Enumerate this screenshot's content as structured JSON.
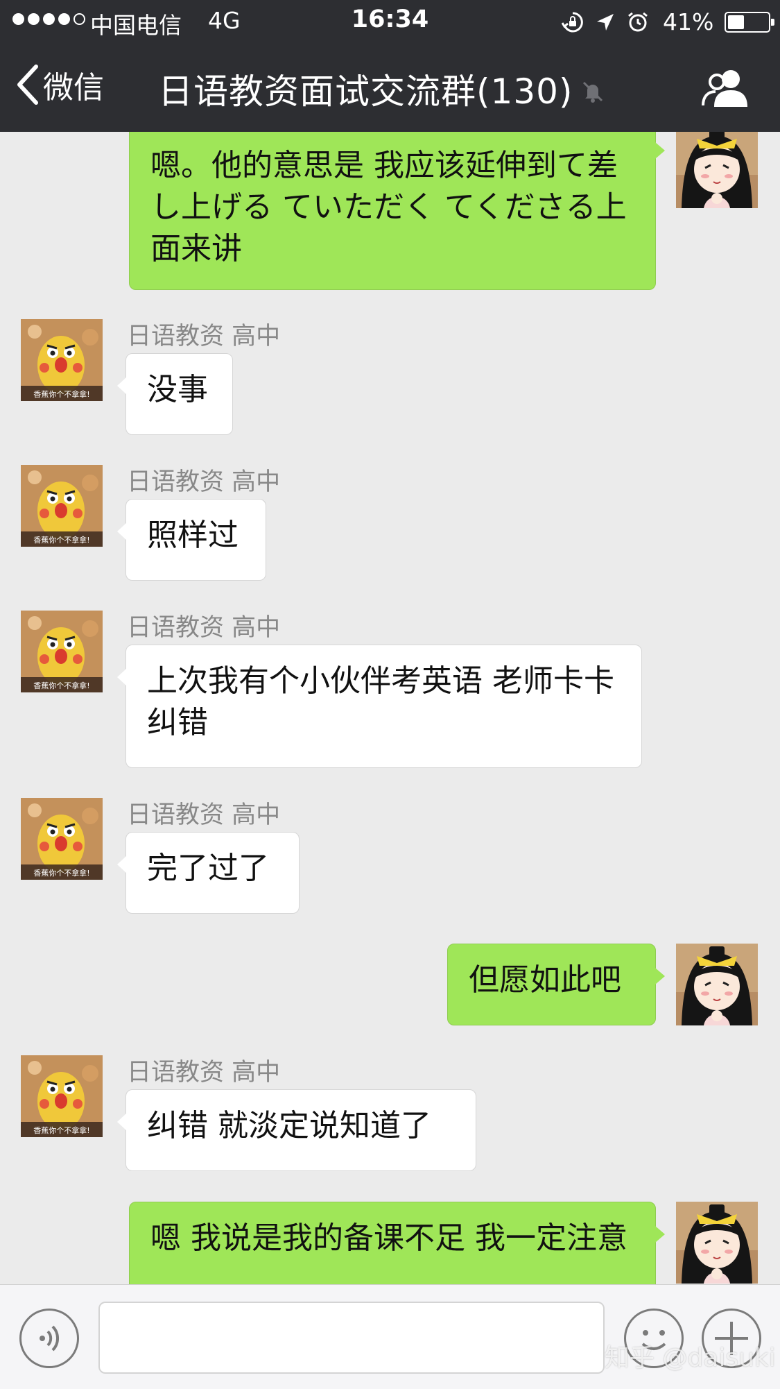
{
  "status_bar": {
    "carrier": "中国电信",
    "network": "4G",
    "time": "16:34",
    "battery_percent_text": "41%",
    "battery_level": 0.41,
    "icons": [
      "signal-dots-icon",
      "orientation-lock-icon",
      "location-arrow-icon",
      "alarm-icon",
      "battery-icon"
    ]
  },
  "nav": {
    "back_label": "微信",
    "title": "日语教资面试交流群(130)",
    "icons": [
      "back-chevron-icon",
      "mute-bell-icon",
      "group-members-icon"
    ]
  },
  "messages": [
    {
      "direction": "out",
      "text": "嗯。他的意思是 我应该延伸到て差し上げる ていただく てくださる上面来讲"
    },
    {
      "direction": "in",
      "sender": "日语教资 高中",
      "avatar_caption": "香蕉你个不拿拿!",
      "text": "没事"
    },
    {
      "direction": "in",
      "sender": "日语教资 高中",
      "avatar_caption": "香蕉你个不拿拿!",
      "text": "照样过"
    },
    {
      "direction": "in",
      "sender": "日语教资 高中",
      "avatar_caption": "香蕉你个不拿拿!",
      "text": "上次我有个小伙伴考英语 老师卡卡纠错"
    },
    {
      "direction": "in",
      "sender": "日语教资 高中",
      "avatar_caption": "香蕉你个不拿拿!",
      "text": "完了过了"
    },
    {
      "direction": "out",
      "text": "但愿如此吧"
    },
    {
      "direction": "in",
      "sender": "日语教资 高中",
      "avatar_caption": "香蕉你个不拿拿!",
      "text": "纠错 就淡定说知道了"
    },
    {
      "direction": "out",
      "text": "嗯 我说是我的备课不足 我一定注意"
    }
  ],
  "input_bar": {
    "icons": [
      "voice-icon",
      "emoji-icon",
      "plus-icon"
    ],
    "input_value": "",
    "watermark": "知乎 @daisuki"
  },
  "colors": {
    "nav_bg": "#2d2e32",
    "chat_bg": "#ebebeb",
    "outgoing_bubble": "#9fe658",
    "incoming_bubble": "#ffffff"
  }
}
